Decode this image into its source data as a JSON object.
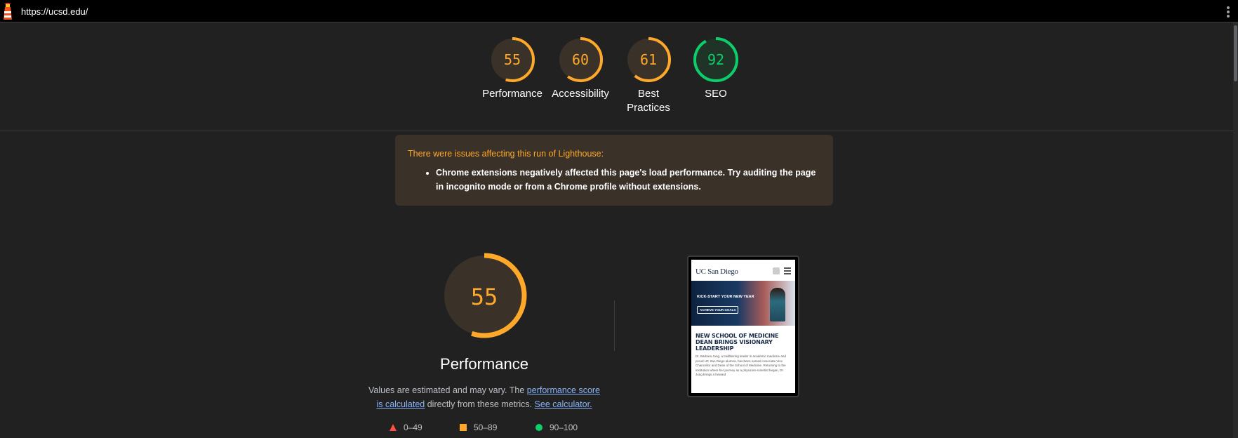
{
  "topbar": {
    "url": "https://ucsd.edu/",
    "logo_icon": "lighthouse-icon",
    "menu_icon": "kebab-menu-icon"
  },
  "colors": {
    "average": "#ffa92b",
    "pass": "#0cce6b",
    "fail": "#ff4e42",
    "link": "#8ab4f8"
  },
  "scores": [
    {
      "value": 55,
      "label": "Performance",
      "color": "#ffa92b"
    },
    {
      "value": 60,
      "label": "Accessibility",
      "color": "#ffa92b"
    },
    {
      "value": 61,
      "label": "Best Practices",
      "color": "#ffa92b"
    },
    {
      "value": 92,
      "label": "SEO",
      "color": "#0cce6b"
    }
  ],
  "warning": {
    "title": "There were issues affecting this run of Lighthouse:",
    "items": [
      "Chrome extensions negatively affected this page's load performance. Try auditing the page in incognito mode or from a Chrome profile without extensions."
    ]
  },
  "performance": {
    "score": 55,
    "title": "Performance",
    "desc_prefix": "Values are estimated and may vary. The ",
    "link_score": "performance score is calculated",
    "desc_middle": " directly from these metrics. ",
    "link_calc": "See calculator."
  },
  "legend": [
    {
      "icon": "triangle-icon",
      "label": "0–49"
    },
    {
      "icon": "square-icon",
      "label": "50–89"
    },
    {
      "icon": "circle-icon",
      "label": "90–100"
    }
  ],
  "screenshot": {
    "brand": "UC San Diego",
    "hero_title": "KICK-START YOUR NEW YEAR",
    "hero_button": "ACHIEVE YOUR GOALS",
    "headline": "NEW SCHOOL OF MEDICINE DEAN BRINGS VISIONARY LEADERSHIP",
    "body": "Dr. Barbara Jung, a trailblazing leader in academic medicine and proud UC San Diego alumna, has been named Associate Vice Chancellor and Dean of the School of Medicine. Returning to the institution where her journey as a physician-scientist began, Dr. Jung brings a forward"
  }
}
